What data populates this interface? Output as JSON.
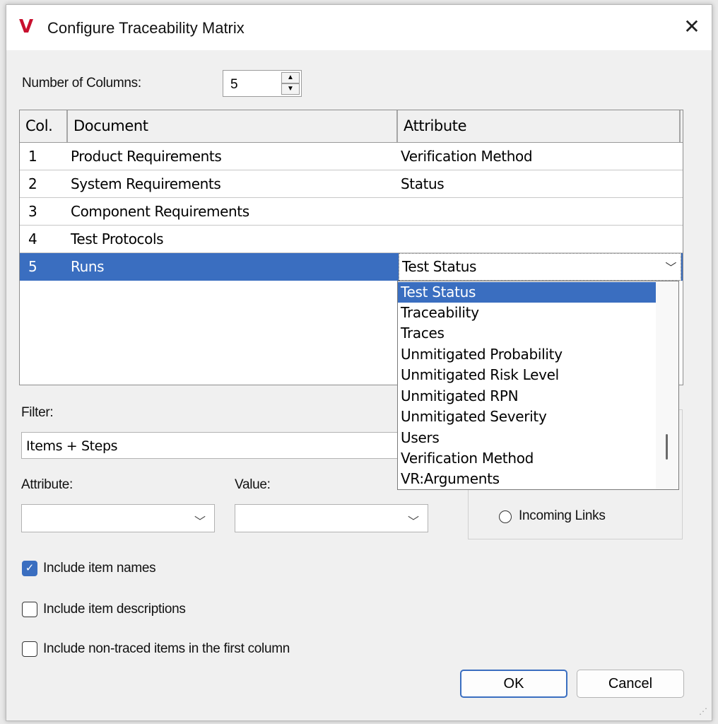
{
  "window": {
    "title": "Configure Traceability Matrix",
    "logo_icon": "vault-v-logo",
    "close_glyph": "✕"
  },
  "columns_count": {
    "label": "Number of Columns:",
    "value": "5"
  },
  "grid": {
    "headers": [
      "Col.",
      "Document",
      "Attribute"
    ],
    "rows": [
      {
        "col": "1",
        "document": "Product Requirements",
        "attribute": "Verification Method"
      },
      {
        "col": "2",
        "document": "System Requirements",
        "attribute": "Status"
      },
      {
        "col": "3",
        "document": "Component Requirements",
        "attribute": ""
      },
      {
        "col": "4",
        "document": "Test Protocols",
        "attribute": ""
      },
      {
        "col": "5",
        "document": "Runs",
        "attribute": "Test Status"
      }
    ],
    "selected_row": 5
  },
  "attribute_dropdown": {
    "selected": "Test Status",
    "options": [
      "Test Status",
      "Traceability",
      "Traces",
      "Unmitigated Probability",
      "Unmitigated Risk Level",
      "Unmitigated RPN",
      "Unmitigated Severity",
      "Users",
      "Verification Method",
      "VR:Arguments"
    ]
  },
  "filter": {
    "label": "Filter:",
    "value": "Items + Steps",
    "attribute_label": "Attribute:",
    "value_label": "Value:",
    "attribute_value": "",
    "value_value": ""
  },
  "links": {
    "incoming_label": "Incoming Links"
  },
  "options": {
    "include_names": {
      "label": "Include item names",
      "checked": true
    },
    "include_descriptions": {
      "label": "Include item descriptions",
      "checked": false
    },
    "include_non_traced": {
      "label": "Include non-traced items in the first column",
      "checked": false
    }
  },
  "buttons": {
    "ok": "OK",
    "cancel": "Cancel"
  },
  "colors": {
    "selection": "#3a6ec0",
    "brand": "#c8102e"
  }
}
